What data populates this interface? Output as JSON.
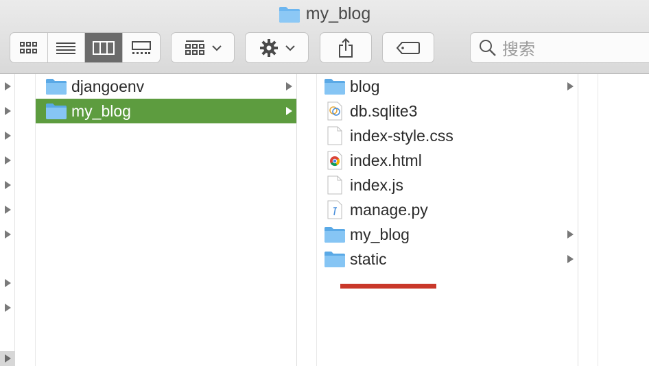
{
  "window": {
    "title": "my_blog"
  },
  "toolbar": {
    "view_buttons": [
      {
        "icon": "icon-view-icon",
        "active": false
      },
      {
        "icon": "list-view-icon",
        "active": false
      },
      {
        "icon": "column-view-icon",
        "active": true
      },
      {
        "icon": "gallery-view-icon",
        "active": false
      }
    ],
    "arrange_icon": "group-icon",
    "action_icon": "gear-icon",
    "share_icon": "share-icon",
    "tags_icon": "tag-icon",
    "search_placeholder": "搜索"
  },
  "columns": {
    "column1": [
      {
        "name": "djangoenv",
        "type": "folder",
        "has_children": true,
        "selected": false
      },
      {
        "name": "my_blog",
        "type": "folder",
        "has_children": true,
        "selected": true
      }
    ],
    "column2": [
      {
        "name": "blog",
        "type": "folder",
        "has_children": true
      },
      {
        "name": "db.sqlite3",
        "type": "sqlite-file",
        "has_children": false
      },
      {
        "name": "index-style.css",
        "type": "blank-file",
        "has_children": false
      },
      {
        "name": "index.html",
        "type": "chrome-html-file",
        "has_children": false
      },
      {
        "name": "index.js",
        "type": "blank-file",
        "has_children": false
      },
      {
        "name": "manage.py",
        "type": "python-file",
        "has_children": false
      },
      {
        "name": "my_blog",
        "type": "folder",
        "has_children": true
      },
      {
        "name": "static",
        "type": "folder",
        "has_children": true
      }
    ]
  },
  "colors": {
    "selection": "#5d9c3f",
    "folder": "#6cb6f0",
    "annotation_underline": "#c9382a"
  }
}
